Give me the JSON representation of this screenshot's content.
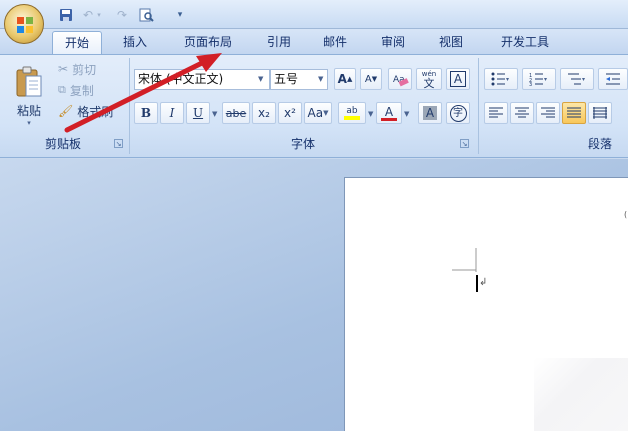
{
  "tabs": [
    {
      "label": "开始",
      "active": true
    },
    {
      "label": "插入"
    },
    {
      "label": "页面布局"
    },
    {
      "label": "引用"
    },
    {
      "label": "邮件"
    },
    {
      "label": "审阅"
    },
    {
      "label": "视图"
    },
    {
      "label": "开发工具"
    }
  ],
  "clipboard": {
    "paste_label": "粘贴",
    "cut_label": "剪切",
    "copy_label": "复制",
    "format_painter_label": "格式刷",
    "group_label": "剪贴板"
  },
  "font": {
    "font_name": "宋体 (中文正文)",
    "font_size": "五号",
    "grow_label": "A",
    "shrink_label": "A",
    "bold": "B",
    "italic": "I",
    "underline": "U",
    "strike": "abe",
    "subscript": "x₂",
    "superscript": "x²",
    "change_case": "Aa",
    "highlight": "ab",
    "font_color": "A",
    "char_shading": "A",
    "enclose": "字",
    "phonetic": "wén",
    "phonetic_char": "文",
    "clear_format": "A",
    "group_label": "字体"
  },
  "paragraph": {
    "group_label": "段落"
  },
  "colors": {
    "accent_red": "#d21f26",
    "highlight_yellow": "#ffff00"
  }
}
